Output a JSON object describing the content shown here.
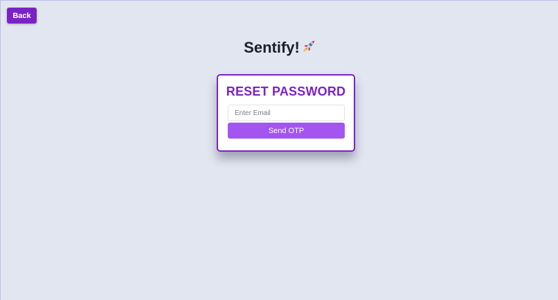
{
  "header": {
    "back_label": "Back"
  },
  "brand": {
    "name": "Sentify!",
    "icon": "rocket-icon"
  },
  "reset_card": {
    "title": "RESET PASSWORD",
    "email_placeholder": "Enter Email",
    "email_value": "",
    "send_label": "Send OTP"
  },
  "colors": {
    "background": "#e2e6f0",
    "primary": "#7b22c6",
    "button": "#a355f0",
    "card": "#ffffff",
    "text_dark": "#1a1e2b"
  }
}
